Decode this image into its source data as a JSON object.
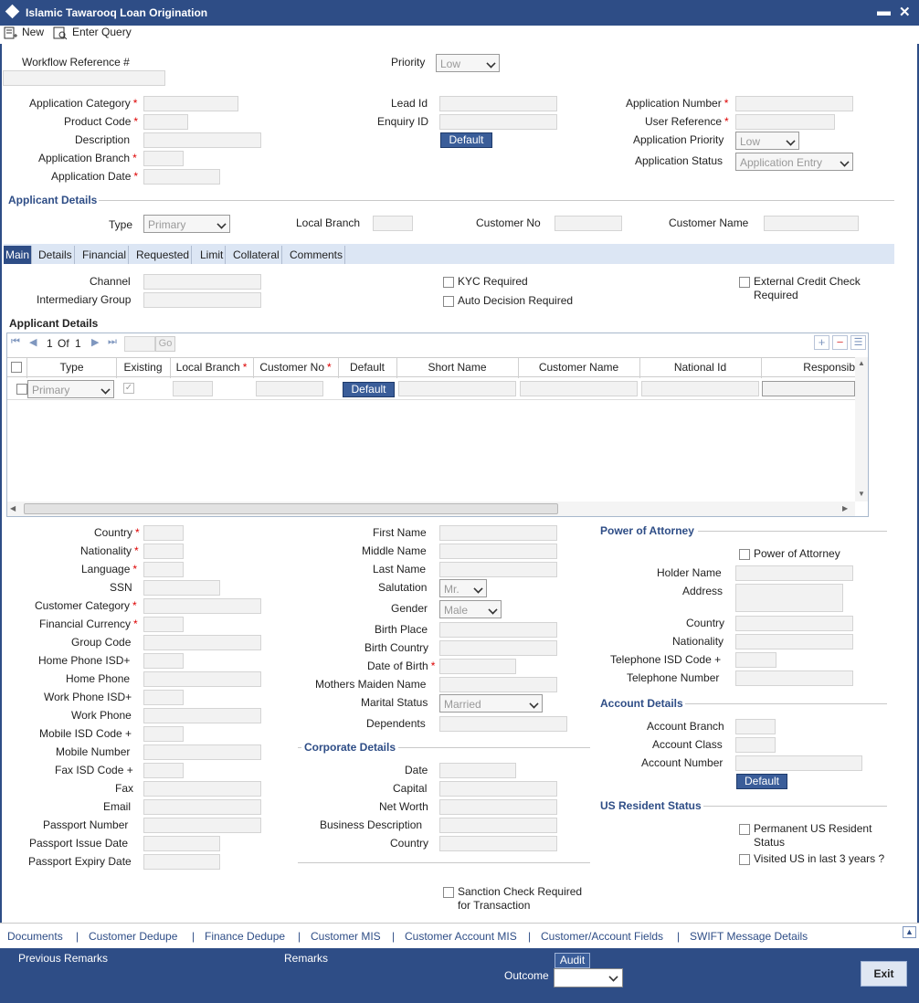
{
  "window": {
    "title": "Islamic Tawarooq Loan Origination",
    "minimize": "▬",
    "close": "✕"
  },
  "toolbar": {
    "new_label": "New",
    "enter_query_label": "Enter Query"
  },
  "header": {
    "workflow_ref_label": "Workflow Reference #",
    "priority_label": "Priority",
    "priority_value": "Low",
    "app_category_label": "Application Category",
    "product_code_label": "Product Code",
    "description_label": "Description",
    "app_branch_label": "Application Branch",
    "app_date_label": "Application Date",
    "lead_id_label": "Lead Id",
    "enquiry_id_label": "Enquiry ID",
    "default_label": "Default",
    "app_number_label": "Application Number",
    "user_ref_label": "User Reference",
    "app_priority_label": "Application Priority",
    "app_priority_value": "Low",
    "app_status_label": "Application Status",
    "app_status_value": "Application Entry"
  },
  "applicant": {
    "section_title": "Applicant Details",
    "type_label": "Type",
    "type_value": "Primary",
    "local_branch_label": "Local Branch",
    "customer_no_label": "Customer No",
    "customer_name_label": "Customer Name"
  },
  "tabs": [
    "Main",
    "Details",
    "Financial",
    "Requested",
    "Limit",
    "Collateral",
    "Comments"
  ],
  "main": {
    "channel_label": "Channel",
    "intermediary_label": "Intermediary Group",
    "kyc_label": "KYC Required",
    "auto_decision_label": "Auto Decision Required",
    "ext_credit_label1": "External Credit Check",
    "ext_credit_label2": "Required",
    "grid_title": "Applicant Details",
    "pager": {
      "page": "1",
      "of": "Of",
      "total": "1",
      "go": "Go"
    },
    "grid_headers": [
      "Type",
      "Existing",
      "Local Branch",
      "Customer No",
      "Default",
      "Short Name",
      "Customer Name",
      "National Id",
      "Responsib"
    ],
    "grid_row": {
      "type": "Primary",
      "default_btn": "Default"
    }
  },
  "personal": {
    "country": "Country",
    "nationality": "Nationality",
    "language": "Language",
    "ssn": "SSN",
    "customer_category": "Customer Category",
    "financial_currency": "Financial Currency",
    "group_code": "Group Code",
    "home_phone_isd": "Home Phone ISD+",
    "home_phone": "Home Phone",
    "work_phone_isd": "Work Phone ISD+",
    "work_phone": "Work Phone",
    "mobile_isd": "Mobile ISD Code +",
    "mobile_number": "Mobile Number",
    "fax_isd": "Fax ISD Code +",
    "fax": "Fax",
    "email": "Email",
    "passport_number": "Passport Number",
    "passport_issue": "Passport Issue Date",
    "passport_expiry": "Passport Expiry Date"
  },
  "names": {
    "first_name": "First Name",
    "middle_name": "Middle Name",
    "last_name": "Last Name",
    "salutation": "Salutation",
    "salutation_value": "Mr.",
    "gender": "Gender",
    "gender_value": "Male",
    "birth_place": "Birth Place",
    "birth_country": "Birth Country",
    "date_of_birth": "Date of Birth",
    "mothers_maiden": "Mothers Maiden Name",
    "marital_status": "Marital Status",
    "marital_value": "Married",
    "dependents": "Dependents"
  },
  "corporate": {
    "title": "Corporate Details",
    "date": "Date",
    "capital": "Capital",
    "net_worth": "Net Worth",
    "business_description": "Business Description",
    "country": "Country"
  },
  "sanction": {
    "label1": "Sanction Check Required",
    "label2": "for Transaction"
  },
  "poa": {
    "title": "Power of Attorney",
    "checkbox_label": "Power of Attorney",
    "holder_name": "Holder Name",
    "address": "Address",
    "country": "Country",
    "nationality": "Nationality",
    "tel_isd": "Telephone ISD Code +",
    "tel_number": "Telephone Number"
  },
  "account": {
    "title": "Account Details",
    "branch": "Account Branch",
    "class": "Account Class",
    "number": "Account Number",
    "default_label": "Default"
  },
  "us_resident": {
    "title": "US Resident Status",
    "permanent1": "Permanent US Resident",
    "permanent2": "Status",
    "visited": "Visited US in last 3 years ?"
  },
  "footer_links": [
    "Documents",
    "Customer Dedupe",
    "Finance Dedupe",
    "Customer MIS",
    "Customer Account MIS",
    "Customer/Account Fields",
    "SWIFT Message Details"
  ],
  "bottom": {
    "previous_remarks": "Previous Remarks",
    "remarks": "Remarks",
    "audit": "Audit",
    "outcome": "Outcome",
    "exit": "Exit"
  }
}
